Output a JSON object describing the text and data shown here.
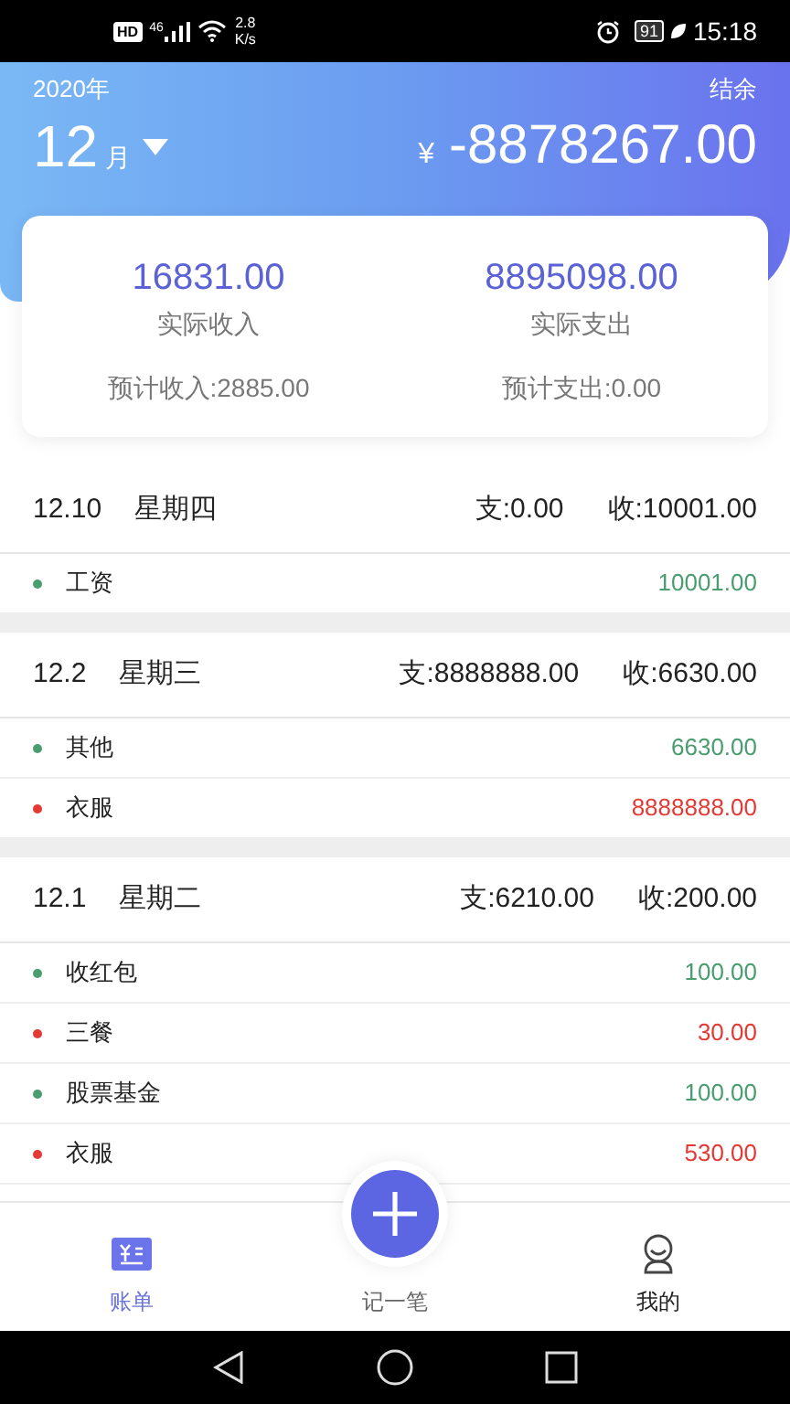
{
  "status_bar": {
    "badge": "HD",
    "network": "46",
    "speed": "2.8",
    "speed_unit": "K/s",
    "battery": "91",
    "time": "15:18"
  },
  "header": {
    "year": "2020年",
    "balance_label": "结余",
    "month": "12",
    "month_unit": "月",
    "currency": "¥",
    "balance": "-8878267.00"
  },
  "summary": {
    "income": "16831.00",
    "income_label": "实际收入",
    "expense": "8895098.00",
    "expense_label": "实际支出",
    "planned_income": "预计收入:2885.00",
    "planned_expense": "预计支出:0.00"
  },
  "days": [
    {
      "date": "12.10",
      "weekday": "星期四",
      "spent": "支:0.00",
      "received": "收:10001.00",
      "items": [
        {
          "name": "工资",
          "amount": "10001.00",
          "color": "#4a9d6f"
        }
      ]
    },
    {
      "date": "12.2",
      "weekday": "星期三",
      "spent": "支:8888888.00",
      "received": "收:6630.00",
      "items": [
        {
          "name": "其他",
          "amount": "6630.00",
          "color": "#4a9d6f"
        },
        {
          "name": "衣服",
          "amount": "8888888.00",
          "color": "#e53935"
        }
      ]
    },
    {
      "date": "12.1",
      "weekday": "星期二",
      "spent": "支:6210.00",
      "received": "收:200.00",
      "items": [
        {
          "name": "收红包",
          "amount": "100.00",
          "color": "#4a9d6f"
        },
        {
          "name": "三餐",
          "amount": "30.00",
          "color": "#e53935"
        },
        {
          "name": "股票基金",
          "amount": "100.00",
          "color": "#4a9d6f"
        },
        {
          "name": "衣服",
          "amount": "530.00",
          "color": "#e53935"
        }
      ]
    }
  ],
  "tabs": [
    {
      "kind": "bills",
      "label": "账单",
      "selected": true
    },
    {
      "kind": "add",
      "label": "记一笔",
      "selected": false
    },
    {
      "kind": "me",
      "label": "我的",
      "selected": false
    }
  ]
}
